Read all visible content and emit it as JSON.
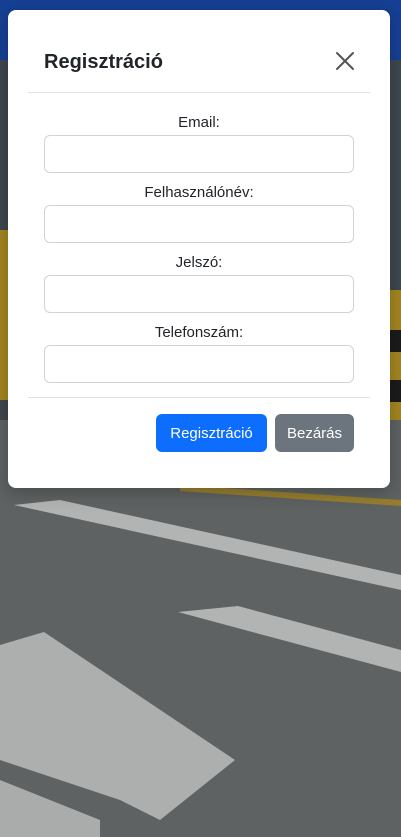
{
  "modal": {
    "title": "Regisztráció",
    "fields": [
      {
        "label": "Email:",
        "value": ""
      },
      {
        "label": "Felhasználónév:",
        "value": ""
      },
      {
        "label": "Jelszó:",
        "value": ""
      },
      {
        "label": "Telefonszám:",
        "value": ""
      }
    ],
    "buttons": {
      "register": "Regisztráció",
      "close": "Bezárás"
    }
  },
  "colors": {
    "header_bar": "#1c4fb6",
    "primary": "#0d6efd",
    "secondary": "#6c757d"
  },
  "icons": {
    "close": "close-icon"
  }
}
